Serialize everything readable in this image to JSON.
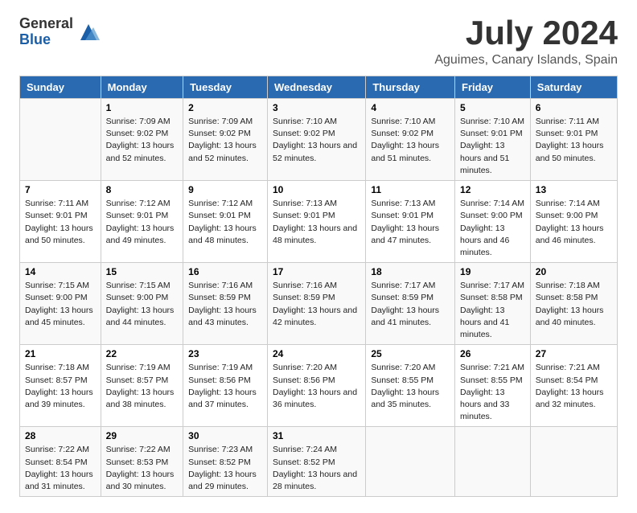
{
  "logo": {
    "general": "General",
    "blue": "Blue"
  },
  "title": {
    "month_year": "July 2024",
    "location": "Aguimes, Canary Islands, Spain"
  },
  "calendar": {
    "headers": [
      "Sunday",
      "Monday",
      "Tuesday",
      "Wednesday",
      "Thursday",
      "Friday",
      "Saturday"
    ],
    "rows": [
      [
        {
          "day": "",
          "info": ""
        },
        {
          "day": "1",
          "info": "Sunrise: 7:09 AM\nSunset: 9:02 PM\nDaylight: 13 hours\nand 52 minutes."
        },
        {
          "day": "2",
          "info": "Sunrise: 7:09 AM\nSunset: 9:02 PM\nDaylight: 13 hours\nand 52 minutes."
        },
        {
          "day": "3",
          "info": "Sunrise: 7:10 AM\nSunset: 9:02 PM\nDaylight: 13 hours\nand 52 minutes."
        },
        {
          "day": "4",
          "info": "Sunrise: 7:10 AM\nSunset: 9:02 PM\nDaylight: 13 hours\nand 51 minutes."
        },
        {
          "day": "5",
          "info": "Sunrise: 7:10 AM\nSunset: 9:01 PM\nDaylight: 13 hours\nand 51 minutes."
        },
        {
          "day": "6",
          "info": "Sunrise: 7:11 AM\nSunset: 9:01 PM\nDaylight: 13 hours\nand 50 minutes."
        }
      ],
      [
        {
          "day": "7",
          "info": "Sunrise: 7:11 AM\nSunset: 9:01 PM\nDaylight: 13 hours\nand 50 minutes."
        },
        {
          "day": "8",
          "info": "Sunrise: 7:12 AM\nSunset: 9:01 PM\nDaylight: 13 hours\nand 49 minutes."
        },
        {
          "day": "9",
          "info": "Sunrise: 7:12 AM\nSunset: 9:01 PM\nDaylight: 13 hours\nand 48 minutes."
        },
        {
          "day": "10",
          "info": "Sunrise: 7:13 AM\nSunset: 9:01 PM\nDaylight: 13 hours\nand 48 minutes."
        },
        {
          "day": "11",
          "info": "Sunrise: 7:13 AM\nSunset: 9:01 PM\nDaylight: 13 hours\nand 47 minutes."
        },
        {
          "day": "12",
          "info": "Sunrise: 7:14 AM\nSunset: 9:00 PM\nDaylight: 13 hours\nand 46 minutes."
        },
        {
          "day": "13",
          "info": "Sunrise: 7:14 AM\nSunset: 9:00 PM\nDaylight: 13 hours\nand 46 minutes."
        }
      ],
      [
        {
          "day": "14",
          "info": "Sunrise: 7:15 AM\nSunset: 9:00 PM\nDaylight: 13 hours\nand 45 minutes."
        },
        {
          "day": "15",
          "info": "Sunrise: 7:15 AM\nSunset: 9:00 PM\nDaylight: 13 hours\nand 44 minutes."
        },
        {
          "day": "16",
          "info": "Sunrise: 7:16 AM\nSunset: 8:59 PM\nDaylight: 13 hours\nand 43 minutes."
        },
        {
          "day": "17",
          "info": "Sunrise: 7:16 AM\nSunset: 8:59 PM\nDaylight: 13 hours\nand 42 minutes."
        },
        {
          "day": "18",
          "info": "Sunrise: 7:17 AM\nSunset: 8:59 PM\nDaylight: 13 hours\nand 41 minutes."
        },
        {
          "day": "19",
          "info": "Sunrise: 7:17 AM\nSunset: 8:58 PM\nDaylight: 13 hours\nand 41 minutes."
        },
        {
          "day": "20",
          "info": "Sunrise: 7:18 AM\nSunset: 8:58 PM\nDaylight: 13 hours\nand 40 minutes."
        }
      ],
      [
        {
          "day": "21",
          "info": "Sunrise: 7:18 AM\nSunset: 8:57 PM\nDaylight: 13 hours\nand 39 minutes."
        },
        {
          "day": "22",
          "info": "Sunrise: 7:19 AM\nSunset: 8:57 PM\nDaylight: 13 hours\nand 38 minutes."
        },
        {
          "day": "23",
          "info": "Sunrise: 7:19 AM\nSunset: 8:56 PM\nDaylight: 13 hours\nand 37 minutes."
        },
        {
          "day": "24",
          "info": "Sunrise: 7:20 AM\nSunset: 8:56 PM\nDaylight: 13 hours\nand 36 minutes."
        },
        {
          "day": "25",
          "info": "Sunrise: 7:20 AM\nSunset: 8:55 PM\nDaylight: 13 hours\nand 35 minutes."
        },
        {
          "day": "26",
          "info": "Sunrise: 7:21 AM\nSunset: 8:55 PM\nDaylight: 13 hours\nand 33 minutes."
        },
        {
          "day": "27",
          "info": "Sunrise: 7:21 AM\nSunset: 8:54 PM\nDaylight: 13 hours\nand 32 minutes."
        }
      ],
      [
        {
          "day": "28",
          "info": "Sunrise: 7:22 AM\nSunset: 8:54 PM\nDaylight: 13 hours\nand 31 minutes."
        },
        {
          "day": "29",
          "info": "Sunrise: 7:22 AM\nSunset: 8:53 PM\nDaylight: 13 hours\nand 30 minutes."
        },
        {
          "day": "30",
          "info": "Sunrise: 7:23 AM\nSunset: 8:52 PM\nDaylight: 13 hours\nand 29 minutes."
        },
        {
          "day": "31",
          "info": "Sunrise: 7:24 AM\nSunset: 8:52 PM\nDaylight: 13 hours\nand 28 minutes."
        },
        {
          "day": "",
          "info": ""
        },
        {
          "day": "",
          "info": ""
        },
        {
          "day": "",
          "info": ""
        }
      ]
    ]
  }
}
